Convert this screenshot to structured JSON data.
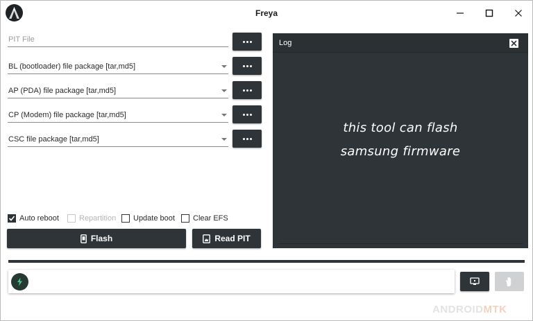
{
  "window": {
    "title": "Freya"
  },
  "form": {
    "pit_placeholder": "PIT File",
    "bl_label": "BL (bootloader) file package [tar,md5]",
    "ap_label": "AP (PDA) file package [tar,md5]",
    "cp_label": "CP (Modem) file package [tar,md5]",
    "csc_label": "CSC file package [tar,md5]"
  },
  "log": {
    "title": "Log",
    "line1": "this tool can flash",
    "line2": "samsung firmware"
  },
  "options": {
    "auto_reboot": {
      "label": "Auto reboot",
      "checked": true
    },
    "repartition": {
      "label": "Repartition",
      "checked": false,
      "disabled": true
    },
    "update_boot": {
      "label": "Update boot",
      "checked": false
    },
    "clear_efs": {
      "label": "Clear EFS",
      "checked": false
    }
  },
  "actions": {
    "flash_label": "Flash",
    "read_pit_label": "Read PIT"
  },
  "progress": {
    "fraction": 1.0
  },
  "status": {
    "text": ""
  },
  "watermark": {
    "part1": "ANDROID",
    "part2": "MTK"
  },
  "icons": {
    "logo": "app-logo-icon",
    "flash": "phone-icon",
    "read_pit": "tablet-icon",
    "status": "lightning-icon",
    "device": "monitor-icon",
    "stop": "hand-icon"
  },
  "colors": {
    "dark": "#2f3438",
    "progress_track": "#aeb2b4",
    "accent_green": "#253a33"
  }
}
